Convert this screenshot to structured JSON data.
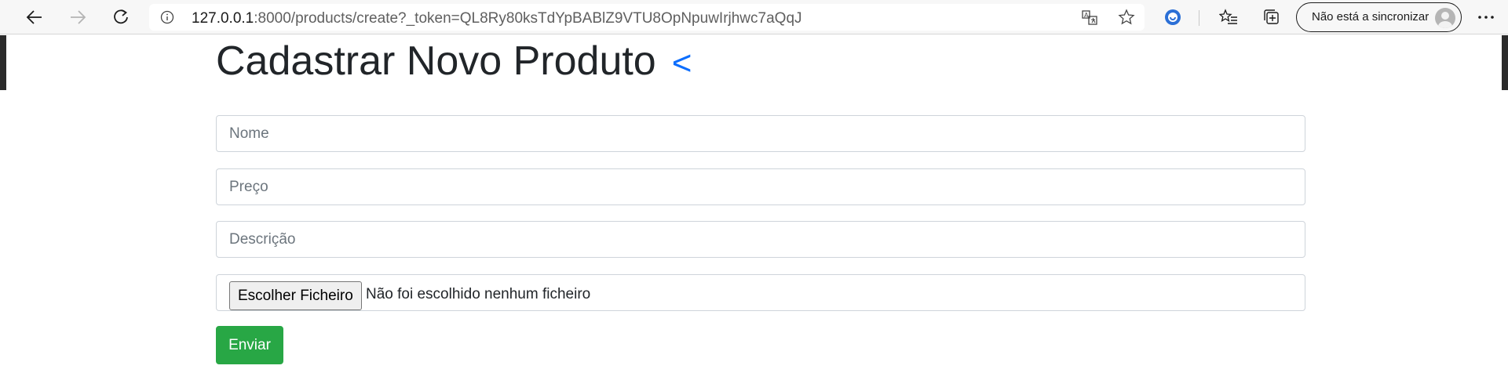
{
  "browser": {
    "url_host": "127.0.0.1",
    "url_rest": ":8000/products/create?_token=QL8Ry80ksTdYpBABlZ9VTU8OpNpuwIrjhwc7aQqJ",
    "sync_label": "Não está a sincronizar",
    "icons": [
      "back-arrow-icon",
      "forward-arrow-icon",
      "refresh-icon",
      "info-icon",
      "translate-icon",
      "star-icon",
      "extension-icon",
      "favorites-icon",
      "collections-icon",
      "avatar-icon",
      "more-icon"
    ]
  },
  "page": {
    "title": "Cadastrar Novo Produto",
    "back_symbol": "<"
  },
  "form": {
    "nome_placeholder": "Nome",
    "preco_placeholder": "Preço",
    "descricao_placeholder": "Descrição",
    "file_button_label": "Escolher Ficheiro",
    "file_status": "Não foi escolhido nenhum ficheiro",
    "submit_label": "Enviar"
  },
  "colors": {
    "title_text": "#212529",
    "back_link": "#0d6efd",
    "submit_bg": "#28a745",
    "input_border": "#ced4da"
  }
}
